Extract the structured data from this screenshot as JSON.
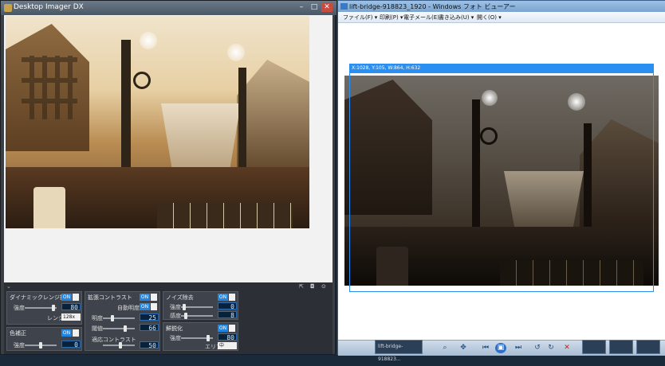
{
  "left_window": {
    "title": "Desktop Imager DX",
    "controls": {
      "minimize": "–",
      "maximize": "□",
      "close": "✕"
    },
    "panel": {
      "collapse_icon": "chevron-down",
      "top_right_icons": [
        "export-icon",
        "camera-icon",
        "settings-icon"
      ],
      "dynamic_range": {
        "title": "ダイナミックレンジ拡張",
        "toggle": "ON",
        "strength_label": "強度",
        "strength_value": "80",
        "range_label": "レンジ",
        "range_value": "128x"
      },
      "color_correction": {
        "title": "色補正",
        "toggle": "ON",
        "strength_label": "強度",
        "strength_value": "0"
      },
      "local_contrast": {
        "title": "拡張コントラスト",
        "toggle": "ON",
        "auto_brightness_label": "自動明度",
        "auto_brightness_toggle": "ON",
        "brightness_label": "明度",
        "brightness_value": "25",
        "threshold_label": "閾値",
        "threshold_value": "66",
        "adaptive_label": "適応コントラスト",
        "adaptive_value": "50"
      },
      "noise_reduction": {
        "title": "ノイズ除去",
        "toggle": "ON",
        "strength_label": "強度",
        "strength_value": "0",
        "sensitivity_label": "感度",
        "sensitivity_value": "8"
      },
      "sharpen": {
        "title": "鮮鋭化",
        "toggle": "ON",
        "strength_label": "強度",
        "strength_value": "80",
        "area_label": "エリア",
        "area_value": "中"
      }
    }
  },
  "right_window": {
    "title": "lift-bridge-918823_1920 - Windows フォト ビューアー",
    "menu": [
      "ファイル(F) ▾",
      "印刷(P) ▾",
      "電子メール(E)",
      "書き込み(U) ▾",
      "開く(O) ▾"
    ],
    "selection_info": "X:1028, Y:105, W:864, H:632",
    "bottom_controls": [
      "zoom-icon",
      "fit-icon",
      "previous-icon",
      "slideshow-icon",
      "next-icon",
      "rotate-left-icon",
      "rotate-right-icon",
      "delete-icon"
    ],
    "taskbar_label": "lift-bridge-918823..."
  },
  "colors": {
    "accent": "#1f86e6",
    "selection": "#2a8ff0",
    "panel_bg": "#2c3036"
  }
}
